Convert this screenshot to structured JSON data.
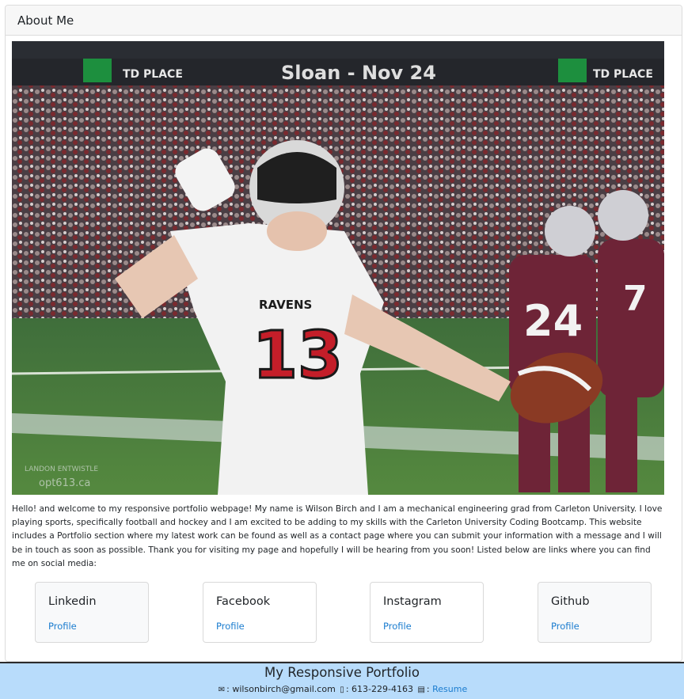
{
  "card": {
    "title": "About Me"
  },
  "hero": {
    "banner_text": "Sloan - Nov 24",
    "sponsor_left": "TD PLACE",
    "sponsor_right": "TD PLACE",
    "jersey_team": "RAVENS",
    "jersey_number": "13",
    "opponent_number_1": "24",
    "opponent_number_2": "7",
    "watermark_line1": "LANDON ENTWISTLE",
    "watermark_line2": "opt613.ca"
  },
  "intro": {
    "text": "Hello! and welcome to my responsive portfolio webpage! My name is Wilson Birch and I am a mechanical engineering grad from Carleton University. I love playing sports, specifically football and hockey and I am excited to be adding to my skills with the Carleton University Coding Bootcamp. This website includes a Portfolio section where my latest work can be found as well as a contact page where you can submit your information with a message and I will be in touch as soon as possible. Thank you for visiting my page and hopefully I will be hearing from you soon! Listed below are links where you can find me on social media:"
  },
  "social": [
    {
      "title": "Linkedin",
      "link": "Profile"
    },
    {
      "title": "Facebook",
      "link": "Profile"
    },
    {
      "title": "Instagram",
      "link": "Profile"
    },
    {
      "title": "Github",
      "link": "Profile"
    }
  ],
  "footer": {
    "title": "My Responsive Portfolio",
    "email": "wilsonbirch@gmail.com",
    "phone": "613-229-4163",
    "resume_label": "Resume",
    "icons": {
      "email": "envelope-icon",
      "phone": "mobile-phone-icon",
      "resume": "file-icon"
    }
  }
}
